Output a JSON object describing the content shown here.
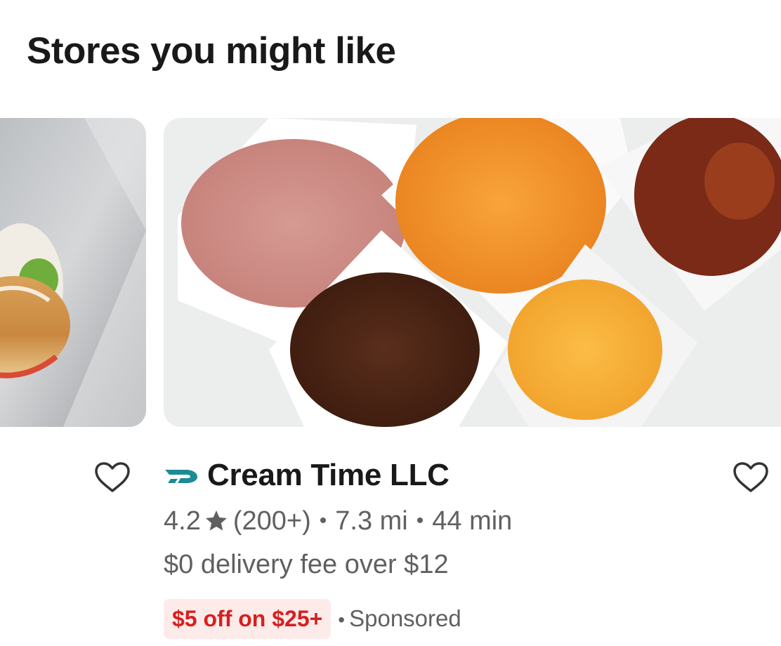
{
  "section": {
    "title": "Stores you might like"
  },
  "store": {
    "name": "Cream Time LLC",
    "rating": "4.2",
    "reviews": "(200+)",
    "distance": "7.3 mi",
    "eta": "44 min",
    "delivery_fee": "$0 delivery fee over $12",
    "promo": "$5 off on $25+",
    "sponsored": "Sponsored",
    "separator": "•"
  },
  "icons": {
    "heart": "heart-outline-icon",
    "star": "star-icon",
    "dashpass": "dashpass-icon"
  },
  "colors": {
    "title": "#191919",
    "secondary_text": "#606060",
    "promo_text": "#d71f1f",
    "promo_bg": "#fdebea",
    "dashpass": "#1d8b95"
  }
}
